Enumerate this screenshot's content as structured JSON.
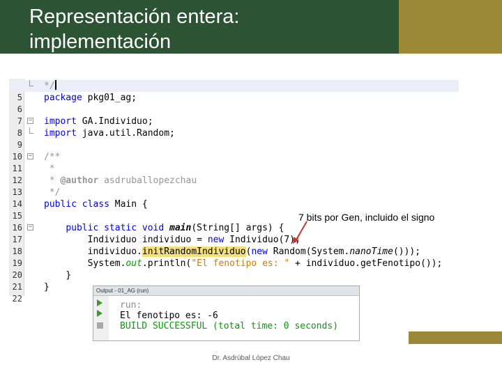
{
  "slide": {
    "title_line1": "Representación entera:",
    "title_line2": "implementación",
    "annotation": "7 bits por Gen, incluido el signo",
    "footer": "Dr. Asdrúbal López Chau"
  },
  "editor": {
    "line_numbers": [
      "5",
      "6",
      "7",
      "8",
      "9",
      "10",
      "11",
      "12",
      "13",
      "14",
      "15",
      "16",
      "17",
      "18",
      "19",
      "20",
      "21",
      "22"
    ],
    "code": {
      "l5": "*/",
      "l6_kw": "package",
      "l6_rest": " pkg01_ag;",
      "l8_kw": "import",
      "l8_rest": " GA.Individuo;",
      "l9_kw": "import",
      "l9_rest": " java.util.Random;",
      "l11": "/**",
      "l12": " *",
      "l13_star": " * ",
      "l13_tag": "@author",
      "l13_rest": " asdruballopezchau",
      "l14": " */",
      "l15_kw": "public class",
      "l15_rest": " Main {",
      "l17_indent": "    ",
      "l17_kw": "public static void",
      "l17_sp": " ",
      "l17_name": "main",
      "l17_rest": "(String[] args) {",
      "l18_a": "        Individuo individuo = ",
      "l18_kw": "new",
      "l18_b": " Individuo(7);",
      "l19_a": "        individuo.",
      "l19_hl": "initRandomIndividuo",
      "l19_b": "(",
      "l19_kw": "new",
      "l19_c": " Random(System.",
      "l19_it": "nanoTime",
      "l19_d": "()));",
      "l20_a": "        System.",
      "l20_field": "out",
      "l20_b": ".println(",
      "l20_str": "\"El fenotipo es: \"",
      "l20_c": " + individuo.getFenotipo());",
      "l21": "    }",
      "l22": "}"
    }
  },
  "output": {
    "tab_title": "Output - 01_AG (run)",
    "line1": "run:",
    "line2": "El fenotipo es: -6",
    "line3": "BUILD SUCCESSFUL (total time: 0 seconds)"
  },
  "colors": {
    "title_bg": "#2b5334",
    "accent_gold": "#9a8a37",
    "keyword": "#0000e6",
    "string": "#ce7b00",
    "success": "#0a9a0a",
    "arrow": "#c0392b"
  }
}
